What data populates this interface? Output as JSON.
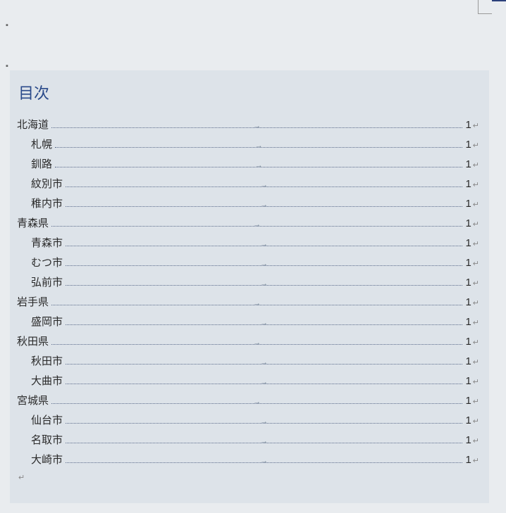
{
  "toc": {
    "title": "目次",
    "entries": [
      {
        "label": "北海道",
        "page": "1",
        "level": 1
      },
      {
        "label": "札幌",
        "page": "1",
        "level": 2
      },
      {
        "label": "釧路",
        "page": "1",
        "level": 2
      },
      {
        "label": "紋別市",
        "page": "1",
        "level": 2
      },
      {
        "label": "稚内市",
        "page": "1",
        "level": 2
      },
      {
        "label": "青森県",
        "page": "1",
        "level": 1
      },
      {
        "label": "青森市",
        "page": "1",
        "level": 2
      },
      {
        "label": "むつ市",
        "page": "1",
        "level": 2
      },
      {
        "label": "弘前市",
        "page": "1",
        "level": 2
      },
      {
        "label": "岩手県",
        "page": "1",
        "level": 1
      },
      {
        "label": "盛岡市",
        "page": "1",
        "level": 2
      },
      {
        "label": "秋田県",
        "page": "1",
        "level": 1
      },
      {
        "label": "秋田市",
        "page": "1",
        "level": 2
      },
      {
        "label": "大曲市",
        "page": "1",
        "level": 2
      },
      {
        "label": "宮城県",
        "page": "1",
        "level": 1
      },
      {
        "label": "仙台市",
        "page": "1",
        "level": 2
      },
      {
        "label": "名取市",
        "page": "1",
        "level": 2
      },
      {
        "label": "大崎市",
        "page": "1",
        "level": 2
      }
    ]
  },
  "marks": {
    "paragraph": "▪",
    "return": "↵",
    "tab": "→",
    "end": "↵"
  }
}
